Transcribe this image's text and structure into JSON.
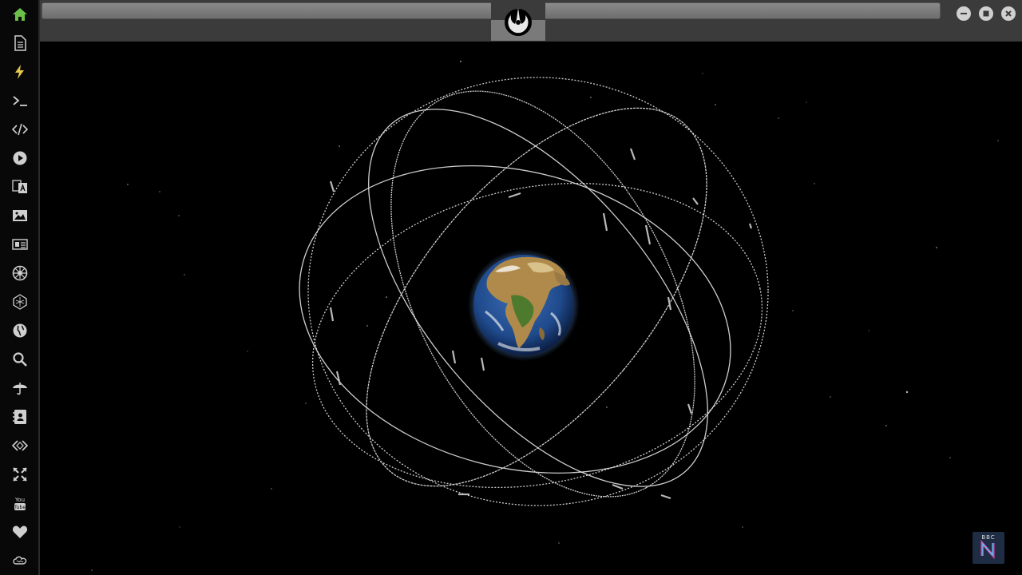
{
  "window": {
    "controls": {
      "minimize": "minimize",
      "maximize": "maximize",
      "close": "close"
    }
  },
  "sidebar": {
    "items": [
      {
        "icon": "home-icon",
        "color": "#6cc04a"
      },
      {
        "icon": "document-icon",
        "color": "#cfcfcf"
      },
      {
        "icon": "lightning-icon",
        "color": "#e6c84a"
      },
      {
        "icon": "terminal-icon",
        "color": "#cfcfcf"
      },
      {
        "icon": "code-icon",
        "color": "#cfcfcf"
      },
      {
        "icon": "play-icon",
        "color": "#cfcfcf"
      },
      {
        "icon": "translate-icon",
        "color": "#cfcfcf"
      },
      {
        "icon": "image-icon",
        "color": "#cfcfcf"
      },
      {
        "icon": "newspaper-icon",
        "color": "#cfcfcf"
      },
      {
        "icon": "galactic-empire-icon",
        "color": "#cfcfcf"
      },
      {
        "icon": "hexagon-icon",
        "color": "#cfcfcf"
      },
      {
        "icon": "globe-icon",
        "color": "#cfcfcf"
      },
      {
        "icon": "search-icon",
        "color": "#cfcfcf"
      },
      {
        "icon": "umbrella-icon",
        "color": "#cfcfcf"
      },
      {
        "icon": "contacts-icon",
        "color": "#cfcfcf"
      },
      {
        "icon": "code-tags-icon",
        "color": "#cfcfcf"
      },
      {
        "icon": "expand-icon",
        "color": "#cfcfcf"
      },
      {
        "icon": "youtube-icon",
        "color": "#cfcfcf"
      },
      {
        "icon": "heart-icon",
        "color": "#cfcfcf"
      },
      {
        "icon": "infinity-cloud-icon",
        "color": "#cfcfcf"
      }
    ]
  },
  "header": {
    "logo": "rebel-alliance-icon"
  },
  "badge": {
    "text": "BBC",
    "letter": "N"
  }
}
